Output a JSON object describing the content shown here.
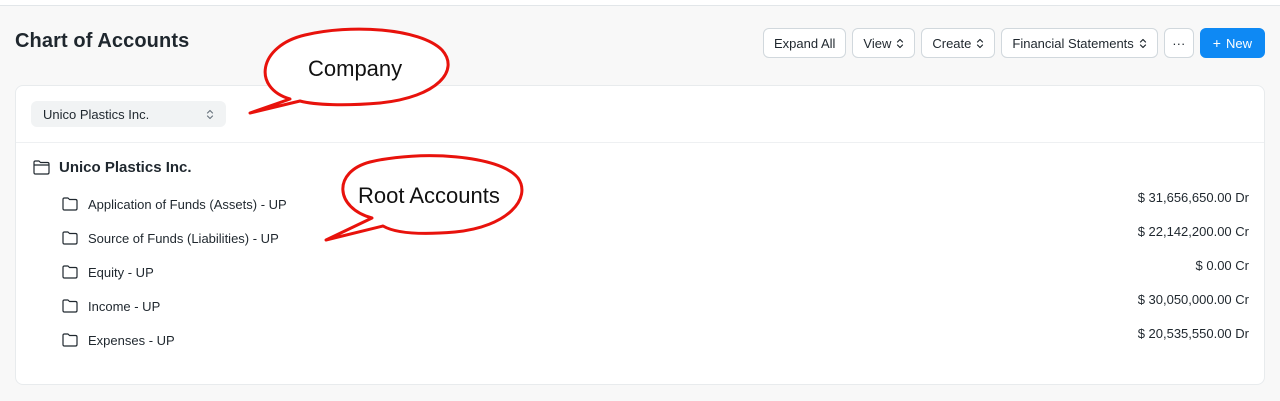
{
  "header": {
    "title": "Chart of Accounts",
    "buttons": {
      "expand_all": "Expand All",
      "view": "View",
      "create": "Create",
      "financial_statements": "Financial Statements",
      "more": "···",
      "new_plus": "+",
      "new": "New"
    }
  },
  "filter": {
    "company": "Unico Plastics Inc."
  },
  "tree": {
    "root": "Unico Plastics Inc.",
    "accounts": [
      {
        "label": "Application of Funds (Assets) - UP",
        "balance": "$ 31,656,650.00 Dr"
      },
      {
        "label": "Source of Funds (Liabilities) - UP",
        "balance": "$ 22,142,200.00 Cr"
      },
      {
        "label": "Equity - UP",
        "balance": "$ 0.00 Cr"
      },
      {
        "label": "Income - UP",
        "balance": "$ 30,050,000.00 Cr"
      },
      {
        "label": "Expenses - UP",
        "balance": "$ 20,535,550.00 Dr"
      }
    ]
  },
  "callouts": {
    "company": "Company",
    "root_accounts": "Root Accounts"
  },
  "colors": {
    "primary": "#0e89f4",
    "callout_stroke": "#e8120c"
  },
  "icons": [
    "chevron-updown-icon",
    "folder-icon",
    "folder-open-icon"
  ]
}
